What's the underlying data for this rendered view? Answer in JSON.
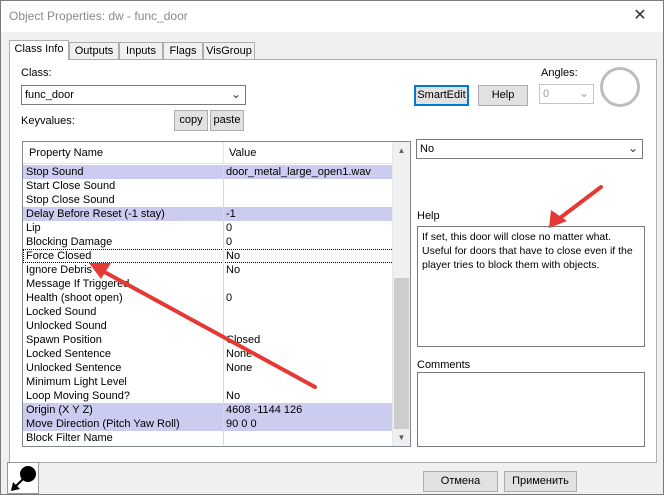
{
  "window": {
    "title": "Object Properties: dw - func_door",
    "close_glyph": "✕"
  },
  "tabs": [
    {
      "label": "Class Info",
      "active": true
    },
    {
      "label": "Outputs",
      "active": false
    },
    {
      "label": "Inputs",
      "active": false
    },
    {
      "label": "Flags",
      "active": false
    },
    {
      "label": "VisGroup",
      "active": false
    }
  ],
  "class_section": {
    "label": "Class:",
    "value": "func_door"
  },
  "keyvalues_section": {
    "label": "Keyvalues:",
    "copy_label": "copy",
    "paste_label": "paste"
  },
  "smartedit_label": "SmartEdit",
  "help_button_label": "Help",
  "angles": {
    "label": "Angles:",
    "value": "0"
  },
  "grid": {
    "header_name": "Property Name",
    "header_value": "Value",
    "rows": [
      {
        "name": "Stop Sound",
        "value": "door_metal_large_open1.wav"
      },
      {
        "name": "Start Close Sound",
        "value": ""
      },
      {
        "name": "Stop Close Sound",
        "value": ""
      },
      {
        "name": "Delay Before Reset (-1 stay)",
        "value": "-1"
      },
      {
        "name": "Lip",
        "value": "0"
      },
      {
        "name": "Blocking Damage",
        "value": "0"
      },
      {
        "name": "Force Closed",
        "value": "No"
      },
      {
        "name": "Ignore Debris",
        "value": "No"
      },
      {
        "name": "Message If Triggered",
        "value": ""
      },
      {
        "name": "Health (shoot open)",
        "value": "0"
      },
      {
        "name": "Locked Sound",
        "value": ""
      },
      {
        "name": "Unlocked Sound",
        "value": ""
      },
      {
        "name": "Spawn Position",
        "value": "Closed"
      },
      {
        "name": "Locked Sentence",
        "value": "None"
      },
      {
        "name": "Unlocked Sentence",
        "value": "None"
      },
      {
        "name": "Minimum Light Level",
        "value": ""
      },
      {
        "name": "Loop Moving Sound?",
        "value": "No"
      },
      {
        "name": "Origin (X Y Z)",
        "value": "4608 -1144 126"
      },
      {
        "name": "Move Direction (Pitch Yaw Roll)",
        "value": "90 0 0"
      },
      {
        "name": "Block Filter Name",
        "value": ""
      }
    ]
  },
  "value_select": {
    "value": "No"
  },
  "help_panel": {
    "label": "Help",
    "text": "If set, this door will close no matter what. Useful for doors that have to close even if the player tries to block them with objects."
  },
  "comments_panel": {
    "label": "Comments",
    "text": ""
  },
  "footer": {
    "cancel_label": "Отмена",
    "apply_label": "Применить"
  },
  "annotation_color": "#e53935"
}
